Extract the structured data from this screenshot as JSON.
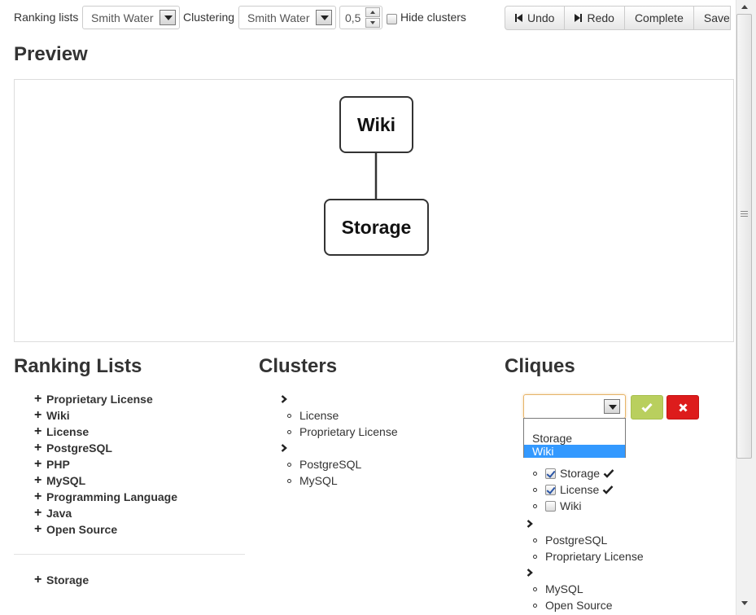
{
  "toolbar": {
    "ranking_label": "Ranking lists",
    "ranking_value": "Smith Water",
    "clustering_label": "Clustering",
    "clustering_value": "Smith Water",
    "threshold_value": "0,5",
    "hide_clusters_label": "Hide clusters",
    "hide_clusters_checked": false,
    "buttons": {
      "undo": "Undo",
      "redo": "Redo",
      "complete": "Complete",
      "save": "Save"
    }
  },
  "preview": {
    "title": "Preview",
    "nodes": [
      "Wiki",
      "Storage"
    ]
  },
  "ranking_lists": {
    "title": "Ranking Lists",
    "items": [
      "Proprietary License",
      "Wiki",
      "License",
      "PostgreSQL",
      "PHP",
      "MySQL",
      "Programming Language",
      "Java",
      "Open Source"
    ],
    "second_group": [
      "Storage"
    ]
  },
  "clusters": {
    "title": "Clusters",
    "groups": [
      [
        "License",
        "Proprietary License"
      ],
      [
        "PostgreSQL",
        "MySQL"
      ]
    ]
  },
  "cliques": {
    "title": "Cliques",
    "select_value": "",
    "dropdown_options": [
      "",
      "Storage",
      "Wiki"
    ],
    "dropdown_selected": "Wiki",
    "checked_items": [
      {
        "label": "Storage",
        "checked": true,
        "confirmed": true
      },
      {
        "label": "License",
        "checked": true,
        "confirmed": true
      },
      {
        "label": "Wiki",
        "checked": false,
        "confirmed": false
      }
    ],
    "groups": [
      [
        "PostgreSQL",
        "Proprietary License"
      ],
      [
        "MySQL",
        "Open Source"
      ]
    ]
  },
  "colors": {
    "ok_button": "#b9cf5e",
    "cancel_button": "#dd1c1c",
    "dropdown_highlight": "#3399ff"
  }
}
